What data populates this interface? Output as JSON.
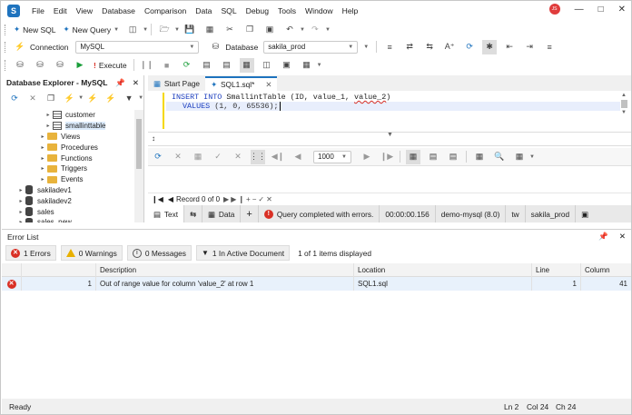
{
  "menu": [
    "File",
    "Edit",
    "View",
    "Database",
    "Comparison",
    "Data",
    "SQL",
    "Debug",
    "Tools",
    "Window",
    "Help"
  ],
  "user_initials": "JS",
  "toolbar1": {
    "new_sql": "New SQL",
    "new_query": "New Query"
  },
  "toolbar2": {
    "connection_label": "Connection",
    "connection_value": "MySQL",
    "database_label": "Database",
    "database_value": "sakila_prod"
  },
  "toolbar3": {
    "execute": "Execute"
  },
  "db_explorer": {
    "title": "Database Explorer - MySQL",
    "tree": [
      {
        "label": "customer",
        "kind": "table",
        "indent": 4
      },
      {
        "label": "smallinttable",
        "kind": "table",
        "indent": 4,
        "selected": true
      },
      {
        "label": "Views",
        "kind": "folder",
        "indent": 3
      },
      {
        "label": "Procedures",
        "kind": "folder",
        "indent": 3
      },
      {
        "label": "Functions",
        "kind": "folder",
        "indent": 3
      },
      {
        "label": "Triggers",
        "kind": "folder",
        "indent": 3
      },
      {
        "label": "Events",
        "kind": "folder",
        "indent": 3
      },
      {
        "label": "sakiladev1",
        "kind": "db",
        "indent": 1
      },
      {
        "label": "sakiladev2",
        "kind": "db",
        "indent": 1
      },
      {
        "label": "sales",
        "kind": "db",
        "indent": 1
      },
      {
        "label": "sales_new",
        "kind": "db",
        "indent": 1
      }
    ]
  },
  "tabs": [
    {
      "label": "Start Page"
    },
    {
      "label": "SQL1.sql*"
    }
  ],
  "code": {
    "line1": [
      "INSERT INTO ",
      "SmallintTable (ID, value_1, ",
      "value_2",
      ")"
    ],
    "line2": [
      "VALUES ",
      "(1, 0, 65536);"
    ]
  },
  "result_toolbar": {
    "page_size": "1000"
  },
  "nav": {
    "record": "Record 0 of 0"
  },
  "status_tabs": {
    "text": "Text",
    "data": "Data",
    "message": "Query completed with errors.",
    "time": "00:00:00.156",
    "conn": "demo-mysql (8.0)",
    "user": "tw",
    "db": "sakila_prod"
  },
  "error_list": {
    "title": "Error List",
    "errors": "1 Errors",
    "warnings": "0 Warnings",
    "messages": "0 Messages",
    "active_doc": "1 In Active Document",
    "displayed": "1 of 1 items displayed",
    "columns": [
      "",
      "",
      "Description",
      "Location",
      "Line",
      "Column"
    ],
    "rows": [
      {
        "num": "1",
        "description": "Out of range value for column 'value_2' at row 1",
        "location": "SQL1.sql",
        "line": "1",
        "column": "41"
      }
    ]
  },
  "statusbar": {
    "ready": "Ready",
    "ln": "Ln 2",
    "col": "Col 24",
    "ch": "Ch 24"
  },
  "colors": {
    "accent": "#1e73be",
    "error": "#d93025",
    "warning": "#e8b000",
    "folder": "#e8b33c"
  }
}
